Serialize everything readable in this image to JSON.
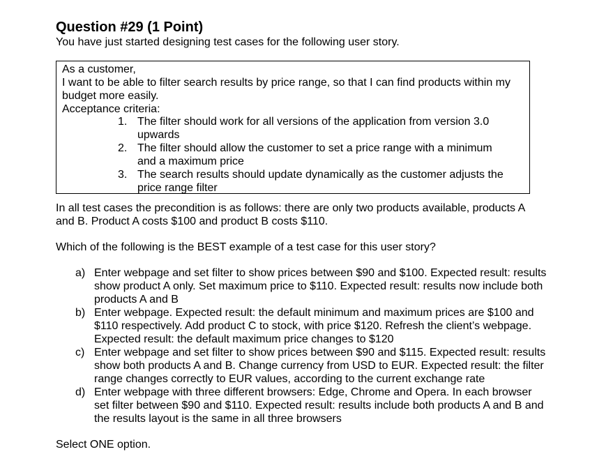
{
  "question": {
    "title": "Question #29 (1 Point)",
    "intro": "You have just started designing test cases for the following user story."
  },
  "user_story": {
    "lines": [
      "As a customer,",
      "I want to be able to filter search results by price range, so that I can find products within my",
      "budget more easily.",
      "Acceptance criteria:"
    ],
    "criteria": [
      {
        "number": "1.",
        "lines": [
          "The filter should work for all versions of the application from version 3.0",
          "upwards"
        ]
      },
      {
        "number": "2.",
        "lines": [
          "The filter should allow the customer to set a price range with a minimum",
          "and a maximum price"
        ]
      },
      {
        "number": "3.",
        "lines": [
          "The search results should update dynamically as the customer adjusts the",
          "price range filter"
        ]
      }
    ]
  },
  "precondition": {
    "lines": [
      "In all test cases the precondition is as follows: there are only two products available, products A",
      "and B. Product A costs $100 and product B costs $110."
    ]
  },
  "prompt": "Which of the following is the BEST example of a test case for this user story?",
  "options": [
    {
      "letter": "a)",
      "lines": [
        "Enter webpage and set filter to show prices between $90 and $100. Expected result: results",
        "show product A only. Set maximum price to $110. Expected result: results now include both",
        "products A and B"
      ]
    },
    {
      "letter": "b)",
      "lines": [
        "Enter webpage. Expected result: the default minimum and maximum prices are $100 and",
        "$110 respectively. Add product C to stock, with price $120. Refresh the client’s webpage.",
        "Expected result: the default maximum price changes to $120"
      ]
    },
    {
      "letter": "c)",
      "lines": [
        "Enter webpage and set filter to show prices between $90 and $115. Expected result: results",
        "show both products A and B. Change currency from USD to EUR. Expected result: the filter",
        "range changes correctly to EUR values, according to the current exchange rate"
      ]
    },
    {
      "letter": "d)",
      "lines": [
        "Enter webpage with three different browsers: Edge, Chrome and Opera. In each browser",
        "set filter between $90 and $110. Expected result: results include both products A and B and",
        "the results layout is the same in all three browsers"
      ]
    }
  ],
  "instruction": "Select ONE option."
}
